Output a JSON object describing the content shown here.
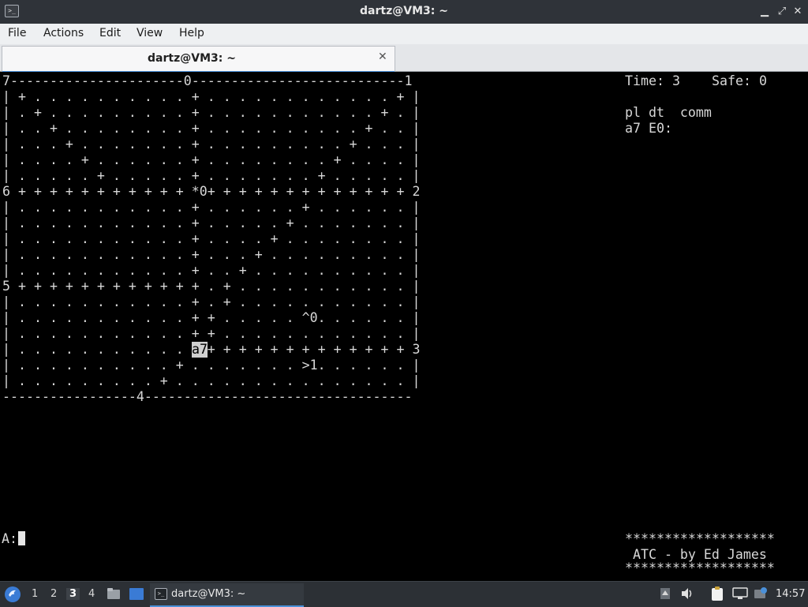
{
  "window": {
    "title": "dartz@VM3: ~"
  },
  "menubar": {
    "items": [
      "File",
      "Actions",
      "Edit",
      "View",
      "Help"
    ]
  },
  "tab": {
    "label": "dartz@VM3: ~"
  },
  "terminal": {
    "radar_lines": [
      "7----------------------0---------------------------1",
      "| + . . . . . . . . . . + . . . . . . . . . . . . + |",
      "| . + . . . . . . . . . + . . . . . . . . . . . + . |",
      "| . . + . . . . . . . . + . . . . . . . . . . + . . |",
      "| . . . + . . . . . . . + . . . . . . . . . + . . . |",
      "| . . . . + . . . . . . + . . . . . . . . + . . . . |",
      "| . . . . . + . . . . . + . . . . . . . + . . . . . |",
      "6 + + + + + + + + + + + *0+ + + + + + + + + + + + + 2",
      "| . . . . . . . . . . . + . . . . . . + . . . . . . |",
      "| . . . . . . . . . . . + . . . . . + . . . . . . . |",
      "| . . . . . . . . . . . + . . . . + . . . . . . . . |",
      "| . . . . . . . . . . . + . . . + . . . . . . . . . |",
      "| . . . . . . . . . . . + . . + . . . . . . . . . . |",
      "5 + + + + + + + + + + + + . + . . . . . . . . . . . |",
      "| . . . . . . . . . . . + . + . . . . . . . . . . . |",
      "| . . . . . . . . . . . + + . . . . . ^0. . . . . . |",
      "| . . . . . . . . . . . + + . . . . . . . . . . . . |",
      "| . . . . . . . . . . . a7+ + + + + + + + + + + + + 3",
      "| . . . . . . . . . . + . . . . . . . >1. . . . . . |",
      "| . . . . . . . . . + . . . . . . . . . . . . . . . |",
      "-----------------4----------------------------------"
    ],
    "selected_plane": "a7",
    "info": {
      "time_label": "Time:",
      "time_value": "3",
      "safe_label": "Safe:",
      "safe_value": "0",
      "header": "pl dt  comm",
      "plane_row": "a7 E0:"
    },
    "prompt": "A:",
    "credits_border": "*******************",
    "credits_text": " ATC - by Ed James"
  },
  "taskbar": {
    "workspaces": [
      "1",
      "2",
      "3",
      "4"
    ],
    "active_workspace": "3",
    "window_button_label": "dartz@VM3: ~",
    "clock": "14:57"
  },
  "icons": {
    "titlebar": [
      "terminal-icon",
      "minimize-icon",
      "maximize-icon",
      "close-icon"
    ],
    "taskbar": [
      "start-menu-icon",
      "file-manager-icon",
      "show-desktop-icon",
      "terminal-icon",
      "up-arrow-icon",
      "volume-icon",
      "clipboard-icon",
      "network-icon",
      "notification-icon"
    ]
  },
  "colors": {
    "titlebar": "#2f3339",
    "taskbar": "#2c3035",
    "accent": "#4a90d9",
    "terminal_bg": "#000000",
    "terminal_fg": "#d8d8d8"
  }
}
